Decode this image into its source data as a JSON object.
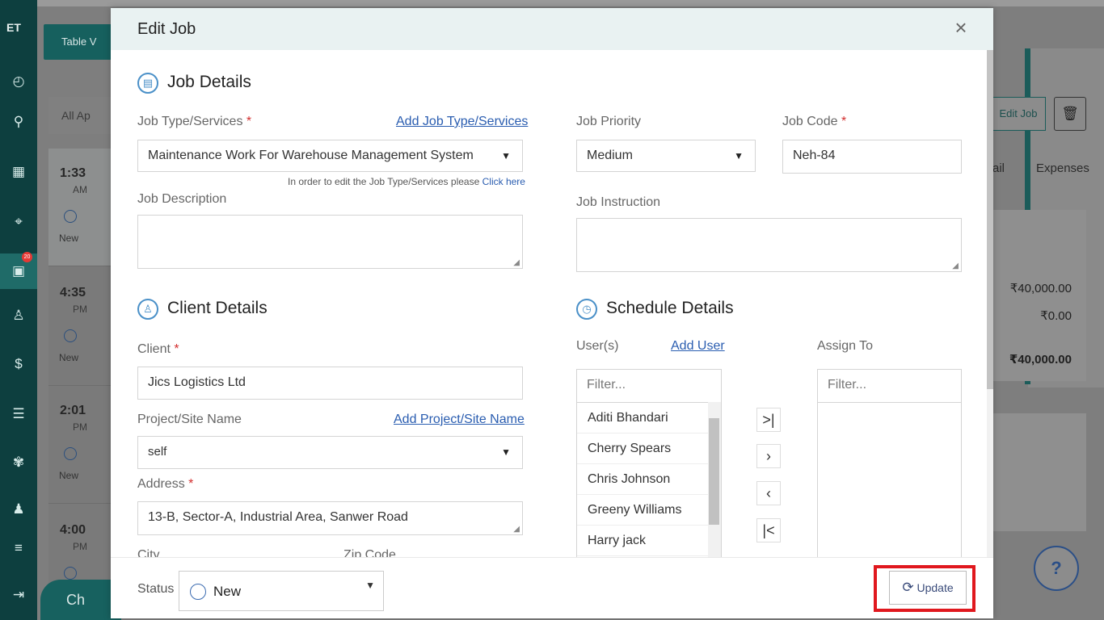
{
  "sidebar": {
    "logo": "ET",
    "badge": "20"
  },
  "background": {
    "table_view_label": "Table V",
    "tabs_label": "All    Ap",
    "list": [
      {
        "time": "1:33",
        "ampm": "AM",
        "status": "New"
      },
      {
        "time": "4:35",
        "ampm": "PM",
        "status": "New"
      },
      {
        "time": "2:01",
        "ampm": "PM",
        "status": "New"
      },
      {
        "time": "4:00",
        "ampm": "PM",
        "status": ""
      }
    ],
    "edit_job_label": "Edit Job",
    "tab_detail": "ail",
    "tab_expenses": "Expenses",
    "amounts": [
      "₹40,000.00",
      "₹0.00",
      "₹40,000.00"
    ],
    "help": "?",
    "chat": "Ch"
  },
  "modal": {
    "title": "Edit Job",
    "job_details": {
      "title": "Job Details",
      "job_type_label": "Job Type/Services",
      "add_job_type": "Add Job Type/Services",
      "job_type_value": "Maintenance Work For Warehouse Management System",
      "hint": "In order to edit the Job Type/Services please",
      "hint_link": "Click here",
      "job_description_label": "Job Description",
      "job_priority_label": "Job Priority",
      "job_priority_value": "Medium",
      "job_code_label": "Job Code",
      "job_code_value": "Neh-84",
      "job_instruction_label": "Job Instruction"
    },
    "client_details": {
      "title": "Client Details",
      "client_label": "Client",
      "client_value": "Jics Logistics Ltd",
      "project_label": "Project/Site Name",
      "add_project": "Add Project/Site Name",
      "project_value": "self",
      "address_label": "Address",
      "address_value": "13-B, Sector-A, Industrial Area, Sanwer Road",
      "city_label": "City",
      "zip_label": "Zip Code"
    },
    "schedule_details": {
      "title": "Schedule Details",
      "users_label": "User(s)",
      "add_user": "Add User",
      "assign_label": "Assign To",
      "filter_placeholder": "Filter...",
      "users": [
        "Aditi Bhandari",
        "Cherry Spears",
        "Chris Johnson",
        "Greeny Williams",
        "Harry jack"
      ]
    },
    "footer": {
      "status_label": "Status",
      "status_value": "New",
      "update_label": "Update"
    }
  }
}
